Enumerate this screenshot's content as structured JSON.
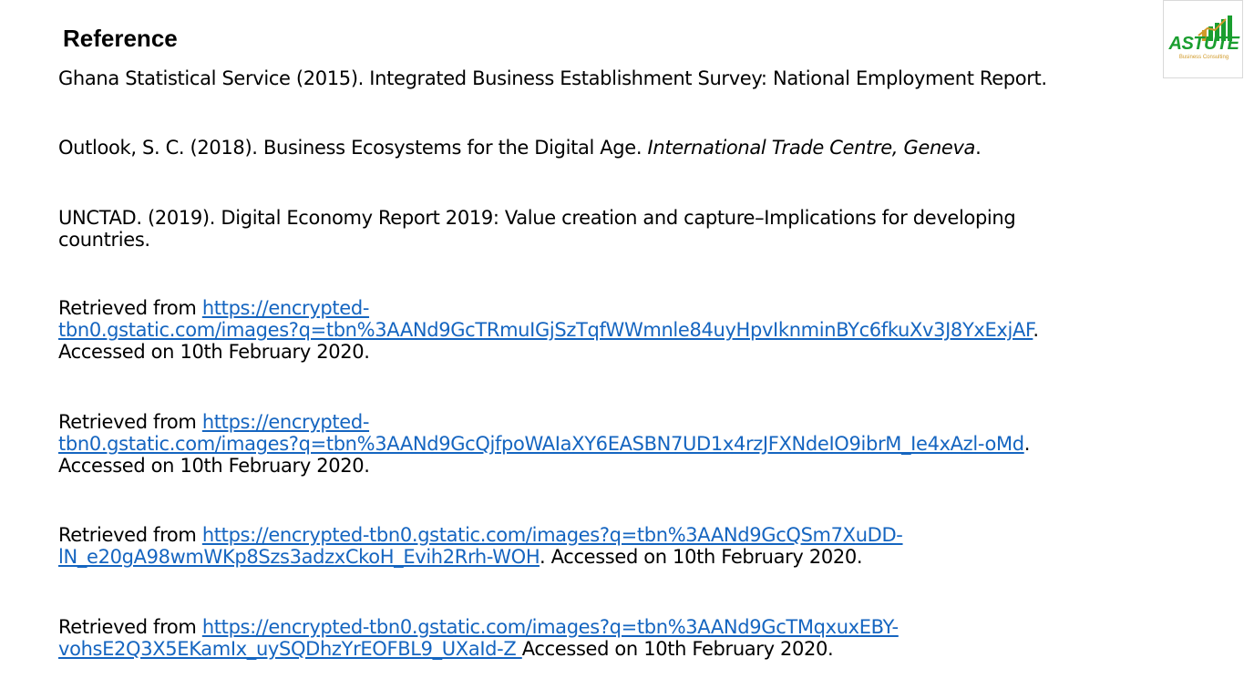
{
  "title": "Reference",
  "logo": {
    "name": "ASTUTE",
    "tagline": "Business Consulting",
    "colors": {
      "name": "#1a9e2f",
      "tagline": "#d19a2a"
    }
  },
  "references": {
    "r1": "Ghana Statistical Service (2015). Integrated Business Establishment Survey: National Employment Report.",
    "r2": {
      "lead": "Outlook, S. C. (2018). Business Ecosystems for the Digital Age. ",
      "italic": "International Trade Centre, Geneva",
      "tail": "."
    },
    "r3": {
      "line1": "UNCTAD. (2019). Digital Economy Report 2019: Value creation and capture–Implications for developing",
      "line2": "countries."
    },
    "r4": {
      "prefix": "Retrieved from  ",
      "link_line1": "https://encrypted-",
      "link_line2": "tbn0.gstatic.com/images?q=tbn%3AANd9GcTRmuIGjSzTqfWWmnle84uyHpvIknminBYc6fkuXv3J8YxExjAF",
      "after_link": ".",
      "accessed": "Accessed on 10th February 2020."
    },
    "r5": {
      "prefix": "Retrieved from  ",
      "link_line1": "https://encrypted-",
      "link_line2": "tbn0.gstatic.com/images?q=tbn%3AANd9GcQjfpoWAIaXY6EASBN7UD1x4rzJFXNdeIO9ibrM_Ie4xAzl-oMd",
      "after_link": ".",
      "accessed": "Accessed on 10th February 2020."
    },
    "r6": {
      "prefix": "Retrieved from ",
      "link_line1": "https://encrypted-tbn0.gstatic.com/images?q=tbn%3AANd9GcQSm7XuDD-",
      "link_line2": "lN_e20gA98wmWKp8Szs3adzxCkoH_Evih2Rrh-WOH",
      "after_link": ". Accessed on 10th February 2020."
    },
    "r7": {
      "prefix": "Retrieved from ",
      "link_line1": "https://encrypted-tbn0.gstatic.com/images?q=tbn%3AANd9GcTMqxuxEBY-",
      "link_line2": "vohsE2Q3X5EKamIx_uySQDhzYrEOFBL9_UXaId-Z ",
      "after_link": "Accessed on 10th February 2020."
    }
  },
  "colors": {
    "link": "#1565c0",
    "text": "#000000"
  }
}
